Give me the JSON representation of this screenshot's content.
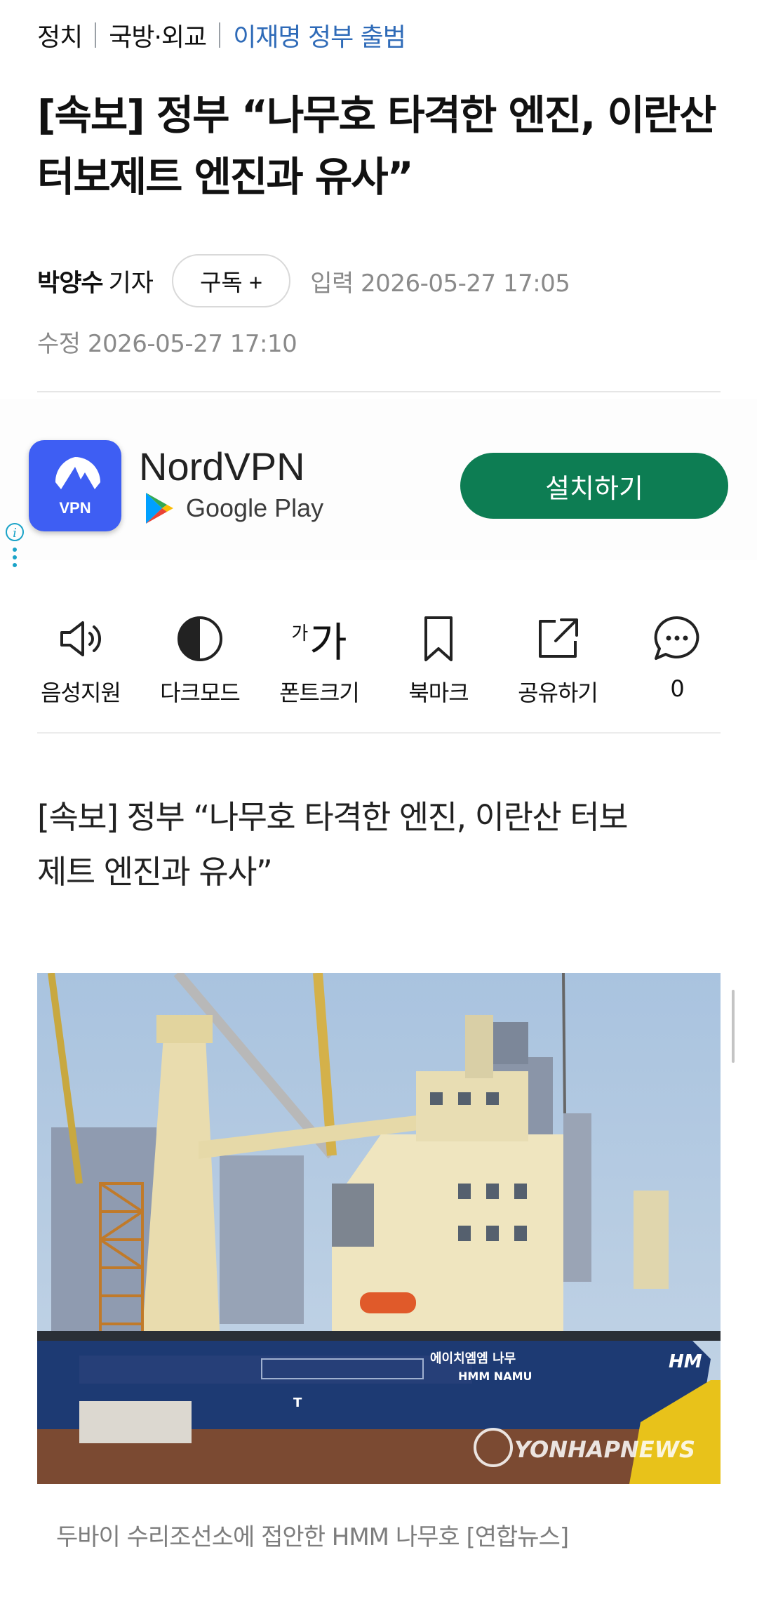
{
  "breadcrumb": {
    "section": "정치",
    "subsection": "국방·외교",
    "series": "이재명 정부 출범"
  },
  "article": {
    "headline_line1": "[속보] 정부 “나무호 타격한 엔진, 이란산",
    "headline_line2": "터보제트 엔진과 유사”",
    "author": "박양수",
    "author_role": "기자",
    "subscribe_label": "구독 +",
    "published": "입력 2026-05-27 17:05",
    "modified": "수정 2026-05-27 17:10",
    "lead_line1": "[속보] 정부 “나무호 타격한 엔진, 이란산 터보",
    "lead_line2": "제트 엔진과 유사”",
    "photo_caption": "두바이 수리조선소에 접안한 HMM 나무호 [연합뉴스]",
    "photo_ship_name_kr": "에이치엠엠 나무",
    "photo_ship_name_en": "HMM NAMU",
    "photo_hull_mark": "T",
    "photo_hull_letters": "HM",
    "photo_watermark": "YONHAPNEWS"
  },
  "ad": {
    "app_name": "NordVPN",
    "icon_text": "VPN",
    "store_label": "Google Play",
    "install_label": "설치하기",
    "icon_color": "#3e5ef3",
    "button_color": "#0d7d53"
  },
  "toolbar": [
    {
      "label": "음성지원",
      "icon": "speaker-icon"
    },
    {
      "label": "다크모드",
      "icon": "half-circle-icon"
    },
    {
      "label": "폰트크기",
      "icon": "font-size-icon",
      "glyph_small": "가",
      "glyph_large": "가"
    },
    {
      "label": "북마크",
      "icon": "bookmark-icon"
    },
    {
      "label": "공유하기",
      "icon": "share-icon"
    },
    {
      "label": "0",
      "icon": "comment-icon"
    }
  ],
  "colors": {
    "link_blue": "#2f6bb8",
    "meta_gray": "#8a8a8a"
  }
}
